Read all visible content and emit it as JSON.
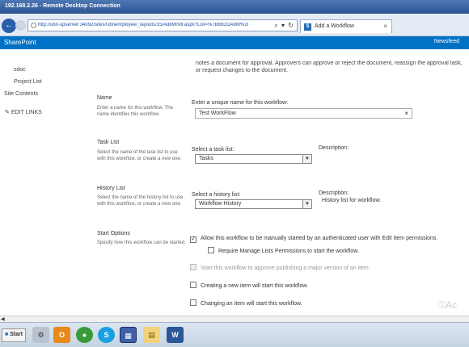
{
  "window": {
    "title": "192.168.2.26 - Remote Desktop Connection"
  },
  "browser": {
    "url": "http://ubn-spserver:34092/sites/Ubnemployee/_layouts/15/AddWrkfl.aspx?List=%7B8B2DA8M%2C",
    "url_actions": "⌕ ▾ ↻",
    "tab_title": "Add a Workflow",
    "tab_icon": "S",
    "tab_close": "×"
  },
  "suite_bar": {
    "brand": "SharePoint",
    "newsfeed": "Newsfeed"
  },
  "left_nav": {
    "items": [
      "sdoc",
      "Project List",
      "Site Contents",
      "EDIT LINKS"
    ]
  },
  "intro_text": "notes a document for approval. Approvers can approve or reject the document, reassign the approval task, or request changes to the document.",
  "sections": {
    "name": {
      "title": "Name",
      "desc": "Enter a name for this workflow. The name identifies this workflow.",
      "field_label": "Enter a unique name for this workflow:",
      "value": "Test WorkFlow",
      "clear": "×"
    },
    "task_list": {
      "title": "Task List",
      "desc": "Select the name of the task list to use with this workflow, or create a new one.",
      "field_label": "Select a task list:",
      "value": "Tasks",
      "desc_label": "Description:"
    },
    "history_list": {
      "title": "History List",
      "desc": "Select the name of the history list to use with this workflow, or create a new one.",
      "field_label": "Select a history list:",
      "value": "Workflow History",
      "desc_label": "Description:",
      "desc_value": "History list for workflow."
    },
    "start_options": {
      "title": "Start Options",
      "desc": "Specify how this workflow can be started.",
      "options": [
        {
          "label": "Allow this workflow to be manually started by an authenticated user with Edit Item permissions.",
          "checked": true,
          "disabled": false
        },
        {
          "label": "Require Manage Lists Permissions to start the workflow.",
          "checked": false,
          "disabled": false
        },
        {
          "label": "Start this workflow to approve publishing a major version of an item.",
          "checked": false,
          "disabled": true
        },
        {
          "label": "Creating a new item will start this workflow.",
          "checked": false,
          "disabled": false
        },
        {
          "label": "Changing an item will start this workflow.",
          "checked": false,
          "disabled": false
        }
      ]
    }
  },
  "taskbar": {
    "start_label": "Start",
    "watermark": "Ac"
  },
  "colors": {
    "suite_bar": "#0072c6",
    "title_bar": "#2d5590"
  }
}
